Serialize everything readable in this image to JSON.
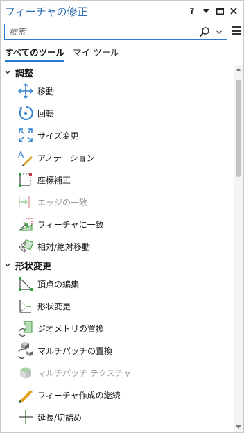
{
  "pane": {
    "title": "フィーチャの修正",
    "help_label": "?",
    "pin_label": "▾"
  },
  "search": {
    "placeholder": "検索"
  },
  "tabs": [
    {
      "label": "すべてのツール",
      "active": true
    },
    {
      "label": "マイ ツール",
      "active": false
    }
  ],
  "groups": [
    {
      "label": "調整",
      "tools": [
        {
          "label": "移動",
          "icon": "move-icon",
          "enabled": true
        },
        {
          "label": "回転",
          "icon": "rotate-icon",
          "enabled": true
        },
        {
          "label": "サイズ変更",
          "icon": "scale-icon",
          "enabled": true
        },
        {
          "label": "アノテーション",
          "icon": "annotation-icon",
          "enabled": true
        },
        {
          "label": "座標補正",
          "icon": "transform-icon",
          "enabled": true
        },
        {
          "label": "エッジの一致",
          "icon": "edgematch-icon",
          "enabled": false
        },
        {
          "label": "フィーチャに一致",
          "icon": "align-features-icon",
          "enabled": true
        },
        {
          "label": "相対/絶対移動",
          "icon": "relative-move-icon",
          "enabled": true
        }
      ]
    },
    {
      "label": "形状変更",
      "tools": [
        {
          "label": "頂点の編集",
          "icon": "edit-vertices-icon",
          "enabled": true
        },
        {
          "label": "形状変更",
          "icon": "reshape-icon",
          "enabled": true
        },
        {
          "label": "ジオメトリの置換",
          "icon": "replace-geometry-icon",
          "enabled": true
        },
        {
          "label": "マルチパッチの置換",
          "icon": "replace-multipatch-icon",
          "enabled": true
        },
        {
          "label": "マルチパッチ テクスチャ",
          "icon": "multipatch-texture-icon",
          "enabled": false
        },
        {
          "label": "フィーチャ作成の継続",
          "icon": "continue-feature-icon",
          "enabled": true
        },
        {
          "label": "延長/切詰め",
          "icon": "extend-trim-icon",
          "enabled": true
        }
      ]
    }
  ],
  "colors": {
    "accent": "#2b7bd0",
    "title": "#2f6fb4",
    "icon_blue": "#2f7fcf",
    "icon_green": "#3a9b3a"
  }
}
